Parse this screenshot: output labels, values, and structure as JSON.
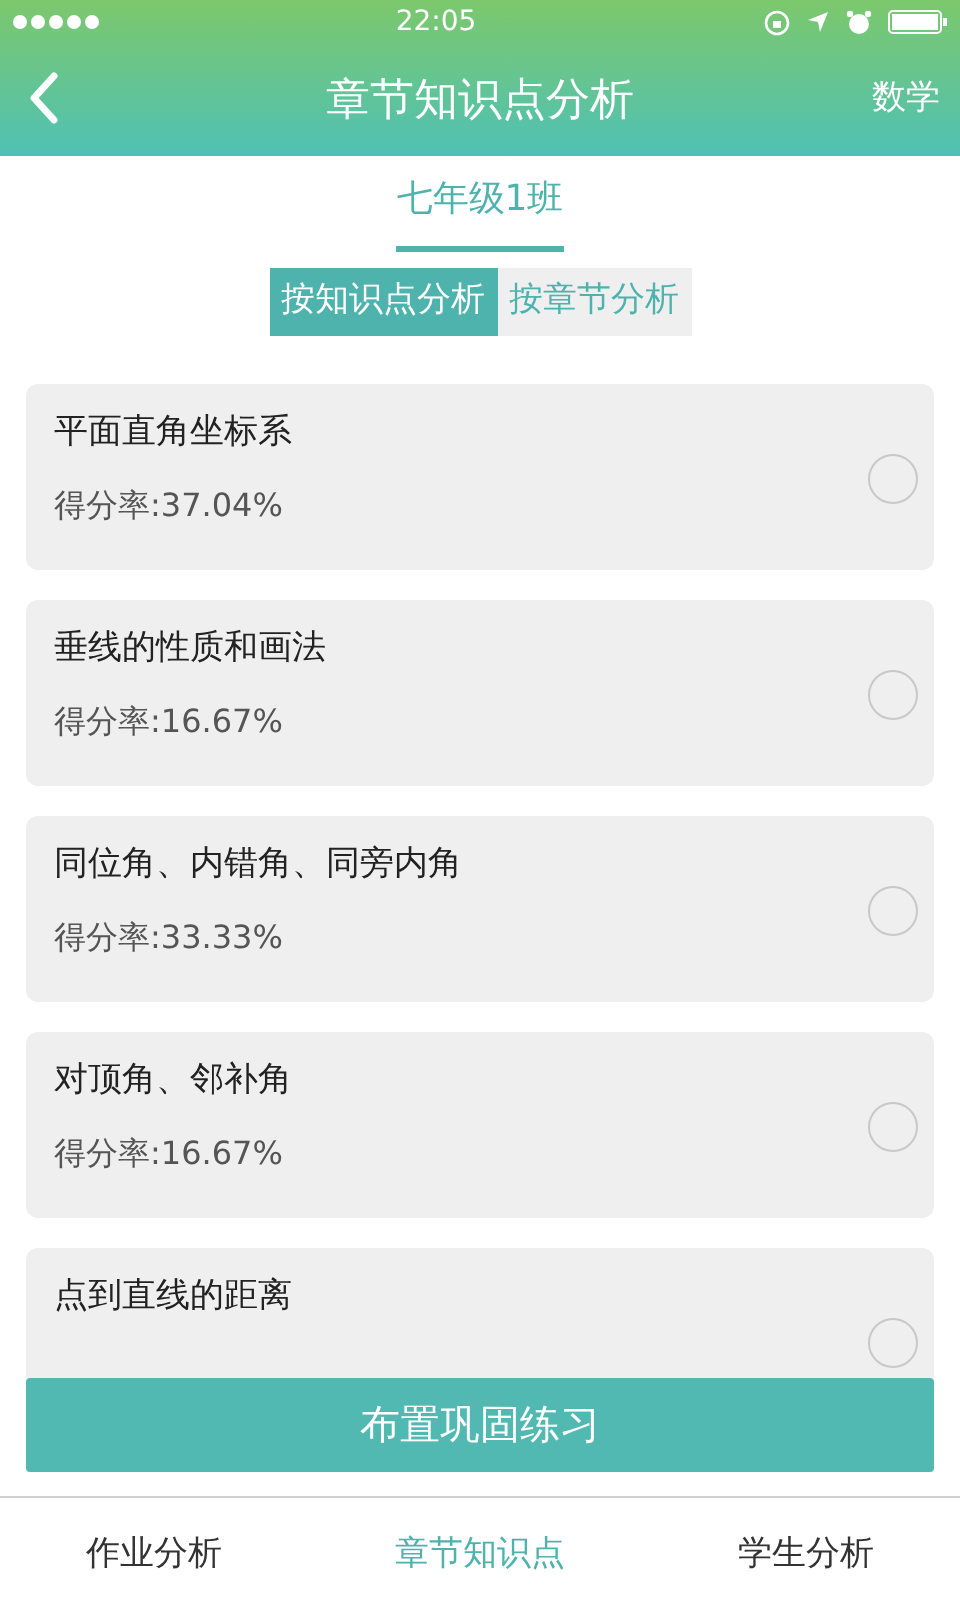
{
  "status_bar": {
    "time": "22:05"
  },
  "header": {
    "title": "章节知识点分析",
    "action": "数学"
  },
  "class_tab": {
    "label": "七年级1班",
    "selected": true
  },
  "segments": [
    {
      "label": "按知识点分析",
      "selected": true
    },
    {
      "label": "按章节分析",
      "selected": false
    }
  ],
  "items": [
    {
      "title": "平面直角坐标系",
      "score": "得分率:37.04%",
      "selected": false
    },
    {
      "title": "垂线的性质和画法",
      "score": "得分率:16.67%",
      "selected": false
    },
    {
      "title": "同位角、内错角、同旁内角",
      "score": "得分率:33.33%",
      "selected": false
    },
    {
      "title": "对顶角、邻补角",
      "score": "得分率:16.67%",
      "selected": false
    },
    {
      "title": "点到直线的距离",
      "selected": false
    }
  ],
  "primary_button": "布置巩固练习",
  "bottom_tabs": [
    {
      "label": "作业分析",
      "selected": false
    },
    {
      "label": "章节知识点",
      "selected": true
    },
    {
      "label": "学生分析",
      "selected": false
    }
  ]
}
